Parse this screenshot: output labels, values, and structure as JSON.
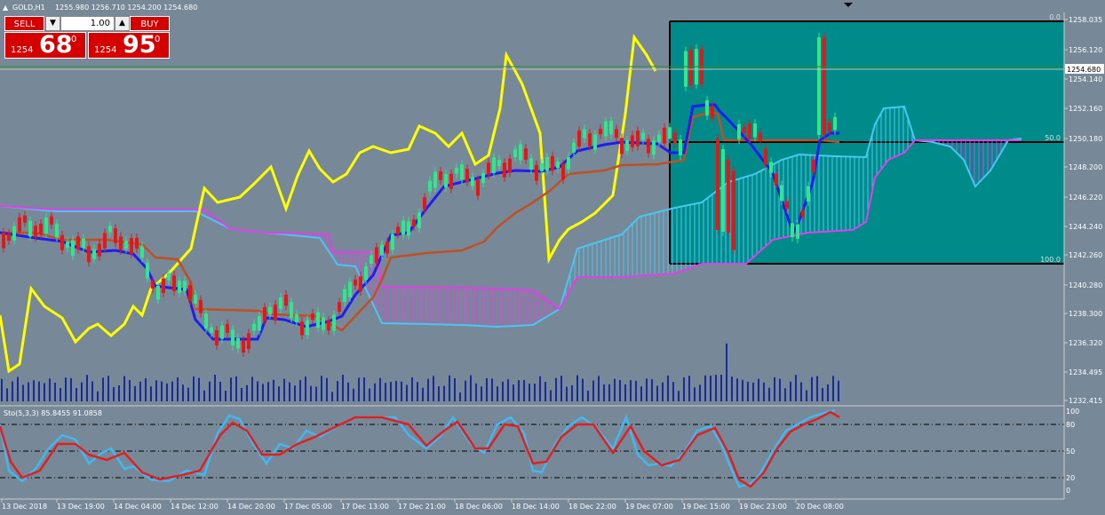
{
  "header": {
    "symbol_title": "GOLD,H1",
    "ohlc": "1255.980 1256.710 1254.200 1254.680"
  },
  "trade_panel": {
    "sell_label": "SELL",
    "buy_label": "BUY",
    "volume": "1.00",
    "down_glyph": "▼",
    "up_glyph": "▲",
    "sell_price_small": "1254",
    "sell_price_big": "68",
    "sell_price_sup": "0",
    "buy_price_small": "1254",
    "buy_price_big": "95",
    "buy_price_sup": "0"
  },
  "price_axis": {
    "labels": [
      "1258.035",
      "1256.120",
      "1254.140",
      "1252.160",
      "1250.180",
      "1248.200",
      "1246.220",
      "1244.240",
      "1242.260",
      "1240.280",
      "1238.300",
      "1236.320",
      "1234.495",
      "1232.415"
    ],
    "current_price": "1254.680"
  },
  "fibo": {
    "top_label": "0.0",
    "mid_label": "50.0",
    "bottom_label": "100.0"
  },
  "oscillator": {
    "title": "Sto(5,3,3) 85.8455 91.0858",
    "levels": [
      "100",
      "80",
      "50",
      "20",
      "0"
    ]
  },
  "time_axis": {
    "labels": [
      "13 Dec 2018",
      "13 Dec 19:00",
      "14 Dec 04:00",
      "14 Dec 12:00",
      "14 Dec 20:00",
      "17 Dec 05:00",
      "17 Dec 13:00",
      "17 Dec 21:00",
      "18 Dec 06:00",
      "18 Dec 14:00",
      "18 Dec 22:00",
      "19 Dec 07:00",
      "19 Dec 15:00",
      "19 Dec 23:00",
      "20 Dec 08:00"
    ]
  },
  "colors": {
    "background": "#778899",
    "bull_candle": "#32e68c",
    "bear_candle": "#e01818",
    "tenkan": "#1e1ef0",
    "kijun": "#c05020",
    "chikou": "#ffff00",
    "cloud_a": "#48c8f0",
    "cloud_b": "#e040e8",
    "fibo_fill": "#008b8b",
    "stoch_main": "#40b8f0",
    "stoch_signal": "#e02020",
    "volume": "#1a2a9a"
  }
}
